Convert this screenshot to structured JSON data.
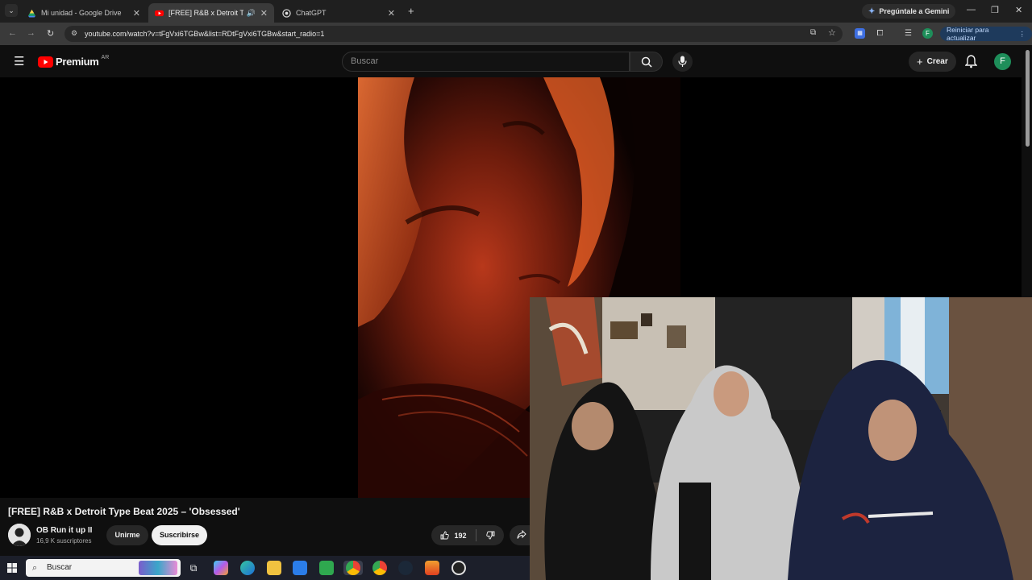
{
  "browser": {
    "tabs": [
      {
        "label": "Mi unidad - Google Drive",
        "active": false,
        "icon": "google-drive-icon"
      },
      {
        "label": "[FREE] R&B x Detroit Type B",
        "active": true,
        "icon": "youtube-icon"
      },
      {
        "label": "ChatGPT",
        "active": false,
        "icon": "chatgpt-icon"
      }
    ],
    "gemini_label": "Pregúntale a Gemini",
    "url": "youtube.com/watch?v=tFgVxi6TGBw&list=RDtFgVxi6TGBw&start_radio=1",
    "restart_label": "Reiniciar para actualizar",
    "profile_initial": "F"
  },
  "youtube": {
    "logo_text": "Premium",
    "region": "AR",
    "search_placeholder": "Buscar",
    "create_label": "Crear",
    "avatar_initial": "F",
    "avatar_color": "#1e8e5a"
  },
  "video": {
    "title": "[FREE] R&B x Detroit Type Beat 2025 – 'Obsessed'",
    "channel": "OB Run it up II",
    "subscribers": "16,9 K suscriptores",
    "join_label": "Unirme",
    "subscribe_label": "Suscribirse",
    "likes": "192"
  },
  "taskbar": {
    "search_label": "Buscar"
  },
  "colors": {
    "accent_red": "#ff0000",
    "thumbnail_orange": "#e2431a"
  }
}
